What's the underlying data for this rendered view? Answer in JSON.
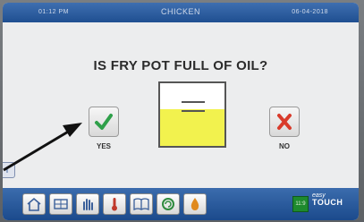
{
  "status_bar": {
    "time": "01:12 PM",
    "title": "CHICKEN",
    "date": "06-04-2018"
  },
  "question": "IS FRY POT FULL OF OIL?",
  "buttons": {
    "yes_label": "YES",
    "no_label": "NO"
  },
  "info_button": {
    "label": "i"
  },
  "toolbar": {
    "counter": "11:9",
    "brand_line1": "easy",
    "brand_line2": "TOUCH",
    "icons": [
      "home-icon",
      "globe-icon",
      "hand-icon",
      "thermometer-icon",
      "book-icon",
      "recycle-icon",
      "oil-drop-icon"
    ]
  },
  "colors": {
    "bar_blue": "#1f4f91",
    "oil_yellow": "#f2f24e",
    "yes_green": "#2fa04a",
    "no_red": "#d93b2b",
    "counter_green": "#1e8a2e"
  },
  "fry_pot": {
    "oil_level": 0.58
  }
}
